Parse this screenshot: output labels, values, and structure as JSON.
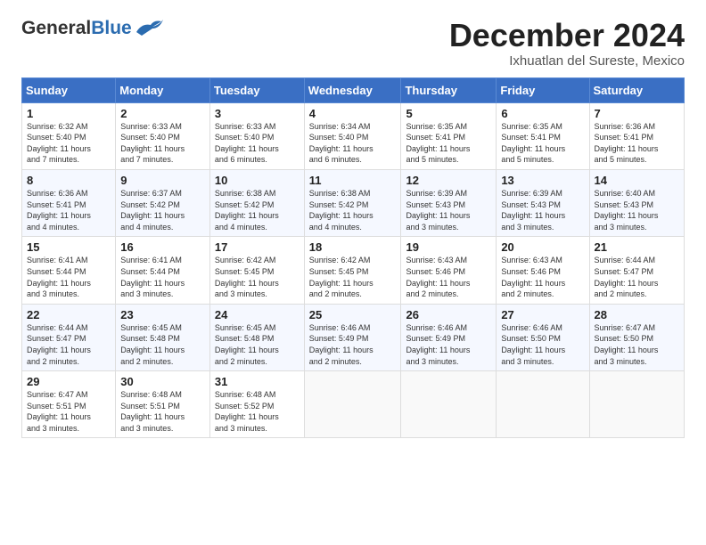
{
  "logo": {
    "general": "General",
    "blue": "Blue"
  },
  "title": {
    "month": "December 2024",
    "location": "Ixhuatlan del Sureste, Mexico"
  },
  "headers": [
    "Sunday",
    "Monday",
    "Tuesday",
    "Wednesday",
    "Thursday",
    "Friday",
    "Saturday"
  ],
  "weeks": [
    [
      {
        "day": "1",
        "sunrise": "6:32 AM",
        "sunset": "5:40 PM",
        "daylight": "11 hours and 7 minutes."
      },
      {
        "day": "2",
        "sunrise": "6:33 AM",
        "sunset": "5:40 PM",
        "daylight": "11 hours and 7 minutes."
      },
      {
        "day": "3",
        "sunrise": "6:33 AM",
        "sunset": "5:40 PM",
        "daylight": "11 hours and 6 minutes."
      },
      {
        "day": "4",
        "sunrise": "6:34 AM",
        "sunset": "5:40 PM",
        "daylight": "11 hours and 6 minutes."
      },
      {
        "day": "5",
        "sunrise": "6:35 AM",
        "sunset": "5:41 PM",
        "daylight": "11 hours and 5 minutes."
      },
      {
        "day": "6",
        "sunrise": "6:35 AM",
        "sunset": "5:41 PM",
        "daylight": "11 hours and 5 minutes."
      },
      {
        "day": "7",
        "sunrise": "6:36 AM",
        "sunset": "5:41 PM",
        "daylight": "11 hours and 5 minutes."
      }
    ],
    [
      {
        "day": "8",
        "sunrise": "6:36 AM",
        "sunset": "5:41 PM",
        "daylight": "11 hours and 4 minutes."
      },
      {
        "day": "9",
        "sunrise": "6:37 AM",
        "sunset": "5:42 PM",
        "daylight": "11 hours and 4 minutes."
      },
      {
        "day": "10",
        "sunrise": "6:38 AM",
        "sunset": "5:42 PM",
        "daylight": "11 hours and 4 minutes."
      },
      {
        "day": "11",
        "sunrise": "6:38 AM",
        "sunset": "5:42 PM",
        "daylight": "11 hours and 4 minutes."
      },
      {
        "day": "12",
        "sunrise": "6:39 AM",
        "sunset": "5:43 PM",
        "daylight": "11 hours and 3 minutes."
      },
      {
        "day": "13",
        "sunrise": "6:39 AM",
        "sunset": "5:43 PM",
        "daylight": "11 hours and 3 minutes."
      },
      {
        "day": "14",
        "sunrise": "6:40 AM",
        "sunset": "5:43 PM",
        "daylight": "11 hours and 3 minutes."
      }
    ],
    [
      {
        "day": "15",
        "sunrise": "6:41 AM",
        "sunset": "5:44 PM",
        "daylight": "11 hours and 3 minutes."
      },
      {
        "day": "16",
        "sunrise": "6:41 AM",
        "sunset": "5:44 PM",
        "daylight": "11 hours and 3 minutes."
      },
      {
        "day": "17",
        "sunrise": "6:42 AM",
        "sunset": "5:45 PM",
        "daylight": "11 hours and 3 minutes."
      },
      {
        "day": "18",
        "sunrise": "6:42 AM",
        "sunset": "5:45 PM",
        "daylight": "11 hours and 2 minutes."
      },
      {
        "day": "19",
        "sunrise": "6:43 AM",
        "sunset": "5:46 PM",
        "daylight": "11 hours and 2 minutes."
      },
      {
        "day": "20",
        "sunrise": "6:43 AM",
        "sunset": "5:46 PM",
        "daylight": "11 hours and 2 minutes."
      },
      {
        "day": "21",
        "sunrise": "6:44 AM",
        "sunset": "5:47 PM",
        "daylight": "11 hours and 2 minutes."
      }
    ],
    [
      {
        "day": "22",
        "sunrise": "6:44 AM",
        "sunset": "5:47 PM",
        "daylight": "11 hours and 2 minutes."
      },
      {
        "day": "23",
        "sunrise": "6:45 AM",
        "sunset": "5:48 PM",
        "daylight": "11 hours and 2 minutes."
      },
      {
        "day": "24",
        "sunrise": "6:45 AM",
        "sunset": "5:48 PM",
        "daylight": "11 hours and 2 minutes."
      },
      {
        "day": "25",
        "sunrise": "6:46 AM",
        "sunset": "5:49 PM",
        "daylight": "11 hours and 2 minutes."
      },
      {
        "day": "26",
        "sunrise": "6:46 AM",
        "sunset": "5:49 PM",
        "daylight": "11 hours and 3 minutes."
      },
      {
        "day": "27",
        "sunrise": "6:46 AM",
        "sunset": "5:50 PM",
        "daylight": "11 hours and 3 minutes."
      },
      {
        "day": "28",
        "sunrise": "6:47 AM",
        "sunset": "5:50 PM",
        "daylight": "11 hours and 3 minutes."
      }
    ],
    [
      {
        "day": "29",
        "sunrise": "6:47 AM",
        "sunset": "5:51 PM",
        "daylight": "11 hours and 3 minutes."
      },
      {
        "day": "30",
        "sunrise": "6:48 AM",
        "sunset": "5:51 PM",
        "daylight": "11 hours and 3 minutes."
      },
      {
        "day": "31",
        "sunrise": "6:48 AM",
        "sunset": "5:52 PM",
        "daylight": "11 hours and 3 minutes."
      },
      null,
      null,
      null,
      null
    ]
  ],
  "labels": {
    "sunrise": "Sunrise: ",
    "sunset": "Sunset: ",
    "daylight": "Daylight: "
  }
}
